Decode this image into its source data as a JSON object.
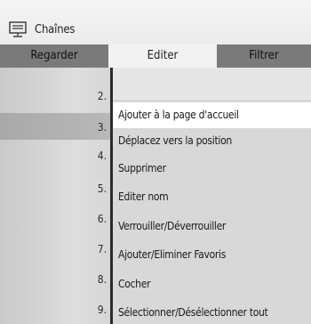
{
  "header": {
    "title": "Chaînes",
    "icon": "tv-icon"
  },
  "tabs": [
    {
      "label": "Regarder"
    },
    {
      "label": "Editer"
    },
    {
      "label": "Filtrer"
    }
  ],
  "channel_numbers": [
    "2.",
    "3.",
    "4.",
    "5.",
    "6.",
    "7.",
    "8.",
    "9."
  ],
  "menu": {
    "items": [
      {
        "label": "Ajouter à la page d'accueil"
      },
      {
        "label": "Déplacez vers la position"
      },
      {
        "label": "Supprimer"
      },
      {
        "label": "Editer nom"
      },
      {
        "label": "Verrouiller/Déverrouiller"
      },
      {
        "label": "Ajouter/Eliminer Favoris"
      },
      {
        "label": "Cocher"
      },
      {
        "label": "Sélectionner/Désélectionner tout"
      }
    ]
  }
}
